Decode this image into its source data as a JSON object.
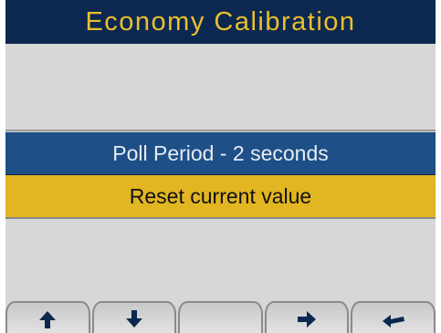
{
  "title": "Economy Calibration",
  "menu": {
    "selected_label": "Poll Period - 2 seconds",
    "highlight_label": "Reset current value"
  },
  "softkeys": [
    {
      "icon": "arrow-up-icon"
    },
    {
      "icon": "arrow-down-icon"
    },
    {
      "icon": ""
    },
    {
      "icon": "arrow-right-icon"
    },
    {
      "icon": "return-arrow-icon"
    }
  ],
  "colors": {
    "title_bg": "#0d2850",
    "title_text": "#e8c02e",
    "selected_bg": "#1e4f86",
    "highlight_bg": "#e2b522",
    "screen_bg": "#d7d7d7"
  }
}
